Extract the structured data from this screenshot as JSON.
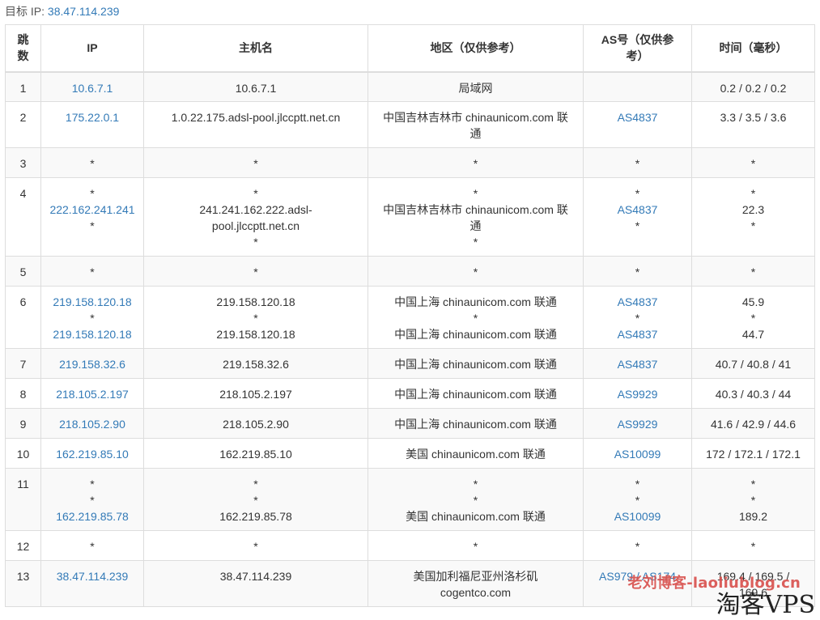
{
  "target": {
    "label": "目标 IP:",
    "ip": "38.47.114.239"
  },
  "headers": {
    "hop": [
      "跳",
      "数"
    ],
    "ip": "IP",
    "host": "主机名",
    "region": "地区（仅供参考）",
    "asn": [
      "AS号（仅供参",
      "考）"
    ],
    "time": "时间（毫秒）"
  },
  "rows": [
    {
      "hop": "1",
      "ip": [
        "10.6.7.1"
      ],
      "host": [
        "10.6.7.1"
      ],
      "region": [
        "局域网"
      ],
      "asn": [
        ""
      ],
      "time": [
        "0.2 / 0.2 / 0.2"
      ]
    },
    {
      "hop": "2",
      "ip": [
        "175.22.0.1"
      ],
      "host": [
        "1.0.22.175.adsl-pool.jlccptt.net.cn"
      ],
      "region": [
        "中国吉林吉林市 chinaunicom.com 联",
        "通"
      ],
      "asn": [
        "AS4837"
      ],
      "time": [
        "3.3 / 3.5 / 3.6"
      ]
    },
    {
      "hop": "3",
      "ip": [
        "*"
      ],
      "host": [
        "*"
      ],
      "region": [
        "*"
      ],
      "asn": [
        "*"
      ],
      "time": [
        "*"
      ]
    },
    {
      "hop": "4",
      "ip": [
        "*",
        "222.162.241.241",
        "*"
      ],
      "host": [
        "*",
        "241.241.162.222.adsl-",
        "pool.jlccptt.net.cn",
        "*"
      ],
      "region": [
        "*",
        "中国吉林吉林市 chinaunicom.com 联",
        "通",
        "*"
      ],
      "asn": [
        "*",
        "AS4837",
        "*"
      ],
      "time": [
        "*",
        "22.3",
        "*"
      ]
    },
    {
      "hop": "5",
      "ip": [
        "*"
      ],
      "host": [
        "*"
      ],
      "region": [
        "*"
      ],
      "asn": [
        "*"
      ],
      "time": [
        "*"
      ]
    },
    {
      "hop": "6",
      "ip": [
        "219.158.120.18",
        "*",
        "219.158.120.18"
      ],
      "host": [
        "219.158.120.18",
        "*",
        "219.158.120.18"
      ],
      "region": [
        "中国上海 chinaunicom.com 联通",
        "*",
        "中国上海 chinaunicom.com 联通"
      ],
      "asn": [
        "AS4837",
        "*",
        "AS4837"
      ],
      "time": [
        "45.9",
        "*",
        "44.7"
      ]
    },
    {
      "hop": "7",
      "ip": [
        "219.158.32.6"
      ],
      "host": [
        "219.158.32.6"
      ],
      "region": [
        "中国上海 chinaunicom.com 联通"
      ],
      "asn": [
        "AS4837"
      ],
      "time": [
        "40.7 / 40.8 / 41"
      ]
    },
    {
      "hop": "8",
      "ip": [
        "218.105.2.197"
      ],
      "host": [
        "218.105.2.197"
      ],
      "region": [
        "中国上海 chinaunicom.com 联通"
      ],
      "asn": [
        "AS9929"
      ],
      "time": [
        "40.3 / 40.3 / 44"
      ]
    },
    {
      "hop": "9",
      "ip": [
        "218.105.2.90"
      ],
      "host": [
        "218.105.2.90"
      ],
      "region": [
        "中国上海 chinaunicom.com 联通"
      ],
      "asn": [
        "AS9929"
      ],
      "time": [
        "41.6 / 42.9 / 44.6"
      ]
    },
    {
      "hop": "10",
      "ip": [
        "162.219.85.10"
      ],
      "host": [
        "162.219.85.10"
      ],
      "region": [
        "美国 chinaunicom.com 联通"
      ],
      "asn": [
        "AS10099"
      ],
      "time": [
        "172 / 172.1 / 172.1"
      ]
    },
    {
      "hop": "11",
      "ip": [
        "*",
        "*",
        "162.219.85.78"
      ],
      "host": [
        "*",
        "*",
        "162.219.85.78"
      ],
      "region": [
        "*",
        "*",
        "美国 chinaunicom.com 联通"
      ],
      "asn": [
        "*",
        "*",
        "AS10099"
      ],
      "time": [
        "*",
        "*",
        "189.2"
      ]
    },
    {
      "hop": "12",
      "ip": [
        "*"
      ],
      "host": [
        "*"
      ],
      "region": [
        "*"
      ],
      "asn": [
        "*"
      ],
      "time": [
        "*"
      ]
    },
    {
      "hop": "13",
      "ip": [
        "38.47.114.239"
      ],
      "host": [
        "38.47.114.239"
      ],
      "region": [
        "美国加利福尼亚州洛杉矶",
        "cogentco.com"
      ],
      "asn": [
        "AS979 / AS174"
      ],
      "time": [
        "169.4 / 169.5 /",
        "169.6"
      ]
    }
  ],
  "watermarks": {
    "blog": "老刘博客-laoliublog.cn",
    "brand": "淘客VPS"
  },
  "colors": {
    "link": "#337ab7",
    "border": "#dddddd",
    "stripe": "#f9f9f9",
    "watermark": "#d9534f"
  }
}
